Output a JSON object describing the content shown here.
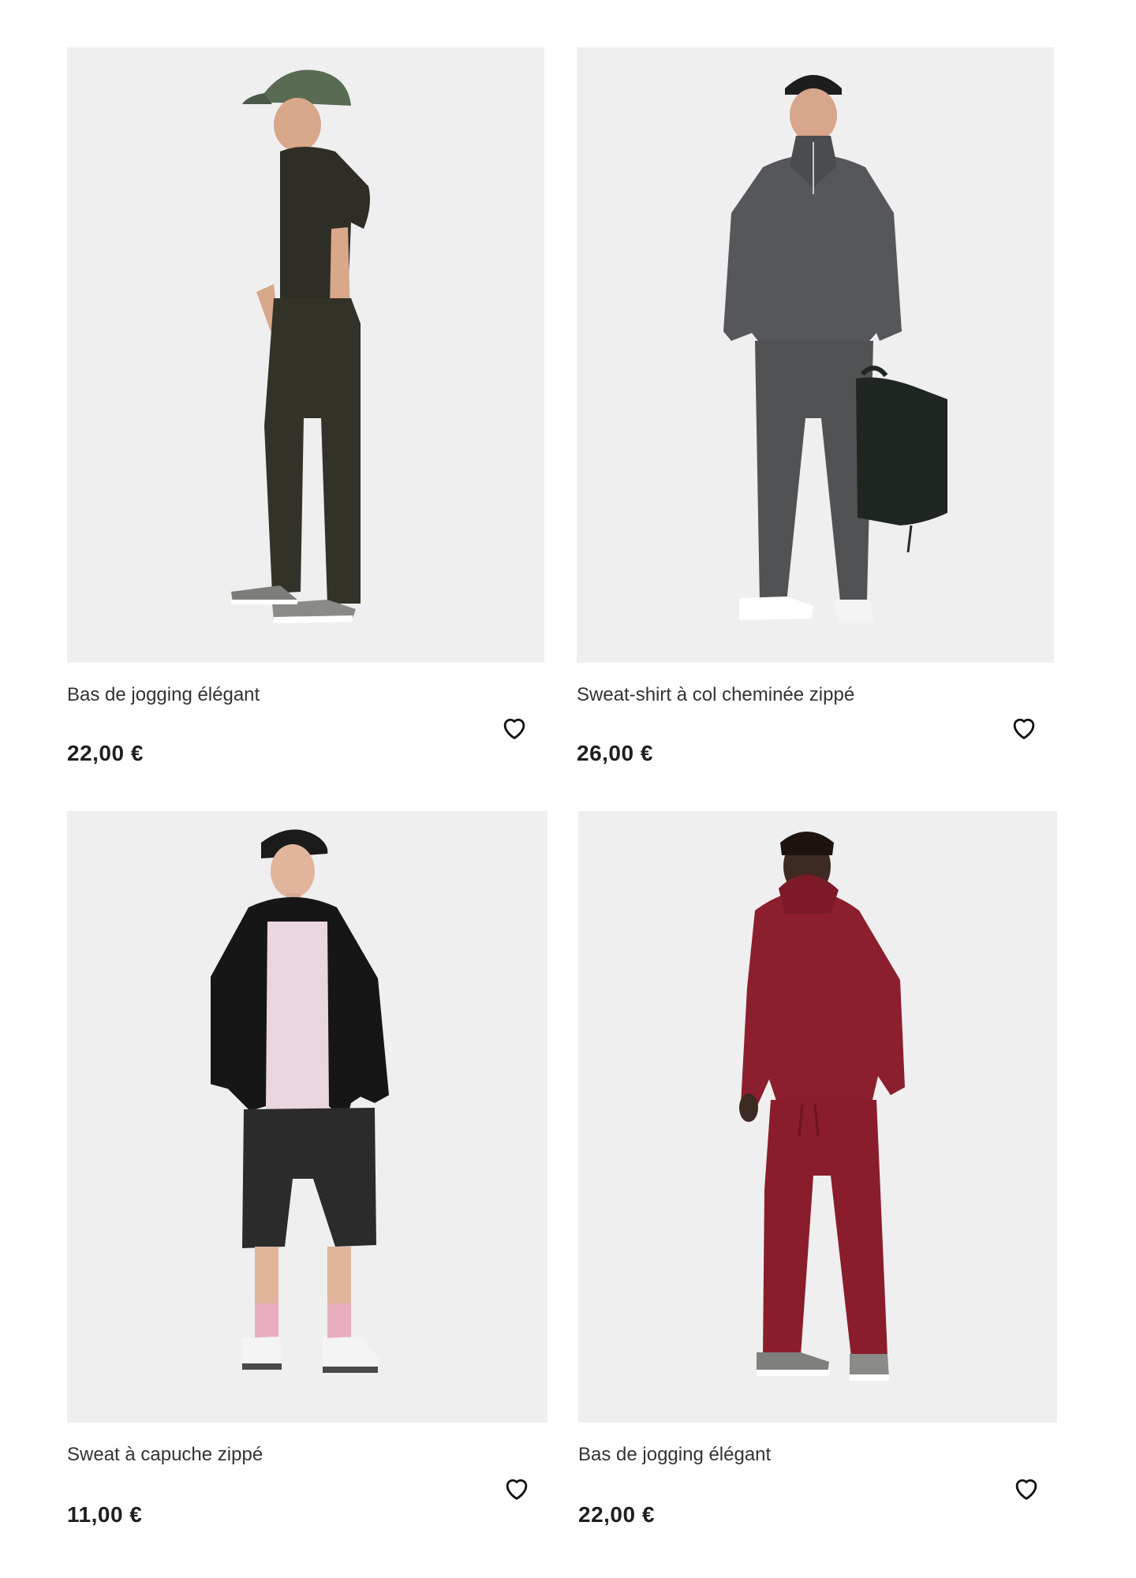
{
  "products": [
    {
      "title": "Bas de jogging élégant",
      "price": "22,00 €",
      "image_description_color": "#3a3a2f",
      "icon": "heart-outline-icon"
    },
    {
      "title": "Sweat-shirt à col cheminée zippé",
      "price": "26,00 €",
      "image_description_color": "#545556",
      "icon": "heart-outline-icon"
    },
    {
      "title": "Sweat à capuche zippé",
      "price": "11,00 €",
      "image_description_color": "#151515",
      "icon": "heart-outline-icon"
    },
    {
      "title": "Bas de jogging élégant",
      "price": "22,00 €",
      "image_description_color": "#8c1d2c",
      "icon": "heart-outline-icon"
    }
  ],
  "colors": {
    "image_background": "#efefef",
    "text": "#333333",
    "price": "#1f1f1f"
  }
}
